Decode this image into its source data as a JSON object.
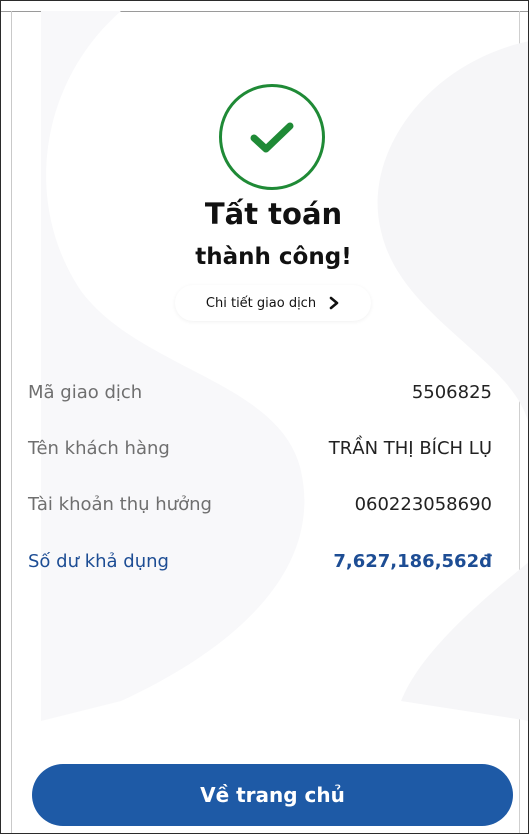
{
  "result": {
    "title_line1": "Tất toán",
    "title_line2": "thành công!",
    "detail_link": "Chi tiết giao dịch"
  },
  "details": [
    {
      "label": "Mã giao dịch",
      "value": "5506825"
    },
    {
      "label": "Tên khách hàng",
      "value": "TRẦN THỊ BÍCH LỤ"
    },
    {
      "label": "Tài khoản thụ hưởng",
      "value": "060223058690"
    },
    {
      "label": "Số dư khả dụng",
      "value": "7,627,186,562đ"
    }
  ],
  "actions": {
    "home_button": "Về trang chủ"
  },
  "colors": {
    "success_green": "#1f8a36",
    "primary_blue": "#1e5aa6",
    "highlight_text_blue": "#1d4d94"
  },
  "icons": {
    "status": "checkmark-icon",
    "detail_arrow": "chevron-right-icon"
  }
}
